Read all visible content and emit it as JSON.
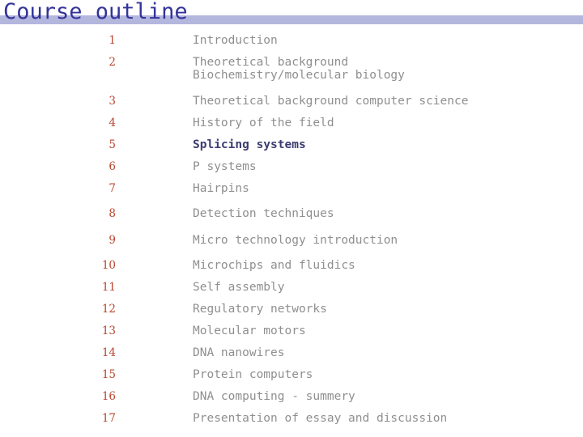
{
  "title": "Course outline",
  "colors": {
    "title_text": "#333399",
    "title_rule": "#b3b6dd",
    "number": "#b8472f",
    "item_text": "#8f8f8f",
    "current_item_text": "#3c3c72",
    "background": "#ffffff"
  },
  "outline": {
    "items": [
      {
        "number": "1",
        "text": "Introduction",
        "subtext": "",
        "current": false
      },
      {
        "number": "2",
        "text": "Theoretical background",
        "subtext": "Biochemistry/molecular biology",
        "current": false
      },
      {
        "number": "3",
        "text": "Theoretical background computer science",
        "subtext": "",
        "current": false
      },
      {
        "number": "4",
        "text": "History of the field",
        "subtext": "",
        "current": false
      },
      {
        "number": "5",
        "text": "Splicing systems",
        "subtext": "",
        "current": true
      },
      {
        "number": "6",
        "text": "P systems",
        "subtext": "",
        "current": false
      },
      {
        "number": "7",
        "text": "Hairpins",
        "subtext": "",
        "current": false
      },
      {
        "number": "8",
        "text": "Detection techniques",
        "subtext": "",
        "current": false
      },
      {
        "number": "9",
        "text": "Micro technology introduction",
        "subtext": "",
        "current": false
      },
      {
        "number": "10",
        "text": "Microchips and fluidics",
        "subtext": "",
        "current": false
      },
      {
        "number": "11",
        "text": "Self assembly",
        "subtext": "",
        "current": false
      },
      {
        "number": "12",
        "text": "Regulatory networks",
        "subtext": "",
        "current": false
      },
      {
        "number": "13",
        "text": "Molecular motors",
        "subtext": "",
        "current": false
      },
      {
        "number": "14",
        "text": "DNA nanowires",
        "subtext": "",
        "current": false
      },
      {
        "number": "15",
        "text": "Protein computers",
        "subtext": "",
        "current": false
      },
      {
        "number": "16",
        "text": "DNA computing - summery",
        "subtext": "",
        "current": false
      },
      {
        "number": "17",
        "text": "Presentation of essay and discussion",
        "subtext": "",
        "current": false
      }
    ]
  }
}
